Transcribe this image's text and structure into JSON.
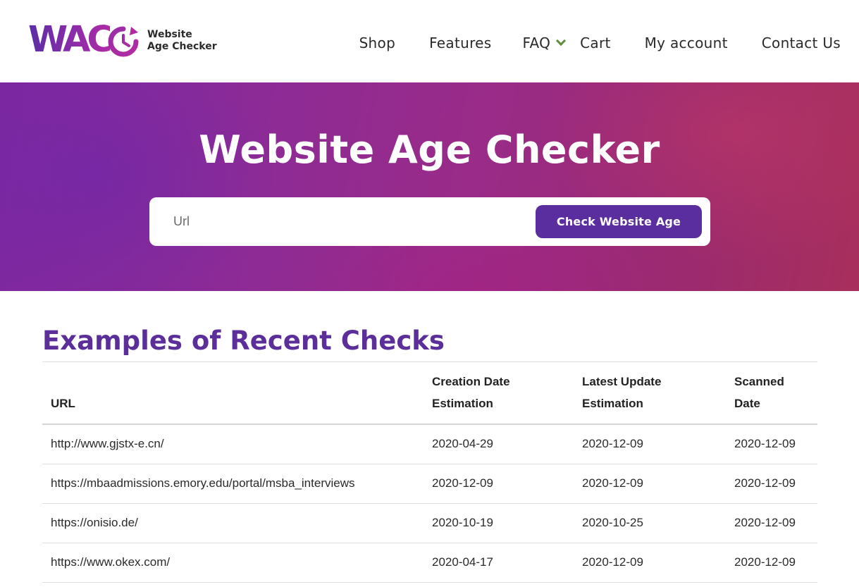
{
  "brand": {
    "logo_letters": "WAC",
    "caption_line1": "Website",
    "caption_line2": "Age Checker",
    "accent_color": "#5b2ea0"
  },
  "nav": {
    "items": [
      {
        "label": "Shop"
      },
      {
        "label": "Features"
      },
      {
        "label": "FAQ",
        "has_dropdown": true
      },
      {
        "label": "Cart"
      },
      {
        "label": "My account"
      },
      {
        "label": "Contact Us"
      }
    ]
  },
  "hero": {
    "title": "Website Age Checker",
    "search_placeholder": "Url",
    "search_value": "",
    "button_label": "Check Website Age"
  },
  "recent": {
    "title": "Examples of Recent Checks",
    "columns": [
      {
        "line1": "",
        "line2": "URL"
      },
      {
        "line1": "Creation Date",
        "line2": "Estimation"
      },
      {
        "line1": "Latest Update",
        "line2": "Estimation"
      },
      {
        "line1": "Scanned",
        "line2": "Date"
      }
    ],
    "rows": [
      {
        "url": "http://www.gjstx-e.cn/",
        "created": "2020-04-29",
        "updated": "2020-12-09",
        "scanned": "2020-12-09"
      },
      {
        "url": "https://mbaadmissions.emory.edu/portal/msba_interviews",
        "created": "2020-12-09",
        "updated": "2020-12-09",
        "scanned": "2020-12-09"
      },
      {
        "url": "https://onisio.de/",
        "created": "2020-10-19",
        "updated": "2020-10-25",
        "scanned": "2020-12-09"
      },
      {
        "url": "https://www.okex.com/",
        "created": "2020-04-17",
        "updated": "2020-12-09",
        "scanned": "2020-12-09"
      }
    ]
  }
}
